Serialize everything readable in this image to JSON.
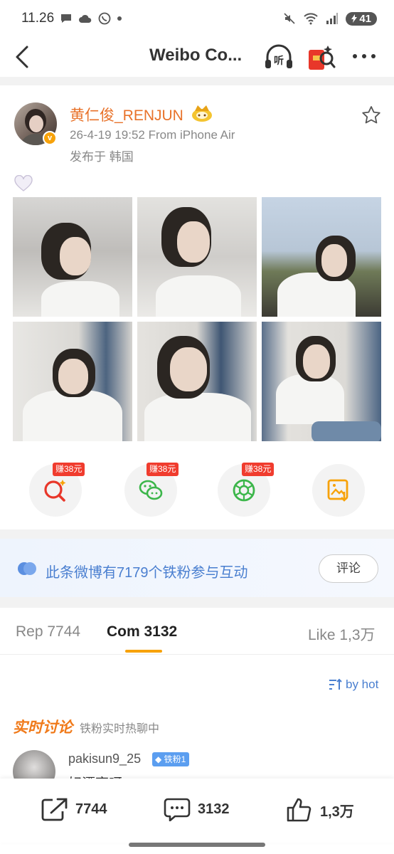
{
  "status_bar": {
    "time": "11.26",
    "battery": "41"
  },
  "nav": {
    "title": "Weibo Co...",
    "listen_label": "听"
  },
  "post": {
    "username": "黄仁俊_RENJUN",
    "meta": "26-4-19 19:52   From iPhone Air",
    "location": "发布于 韩国"
  },
  "share": {
    "earn_label": "赚38元"
  },
  "fans_banner": {
    "text": "此条微博有7179个铁粉参与互动",
    "comment_button": "评论"
  },
  "tabs": [
    {
      "label": "Rep 7744"
    },
    {
      "label": "Com 3132"
    },
    {
      "label": "Like 1,3万"
    }
  ],
  "sort": {
    "label": "by hot"
  },
  "realtime": {
    "title": "实时讨论",
    "subtitle": "铁粉实时热聊中"
  },
  "comment": {
    "username": "pakisun9_25",
    "badge": "铁粉1",
    "text": "好漂亮呀"
  },
  "actions": {
    "repost": "7744",
    "comment": "3132",
    "like": "1,3万"
  },
  "colors": {
    "accent_orange": "#f7a20a",
    "username_orange": "#e8722a",
    "link_blue": "#4a7fd0",
    "earn_red": "#f03c2e"
  }
}
